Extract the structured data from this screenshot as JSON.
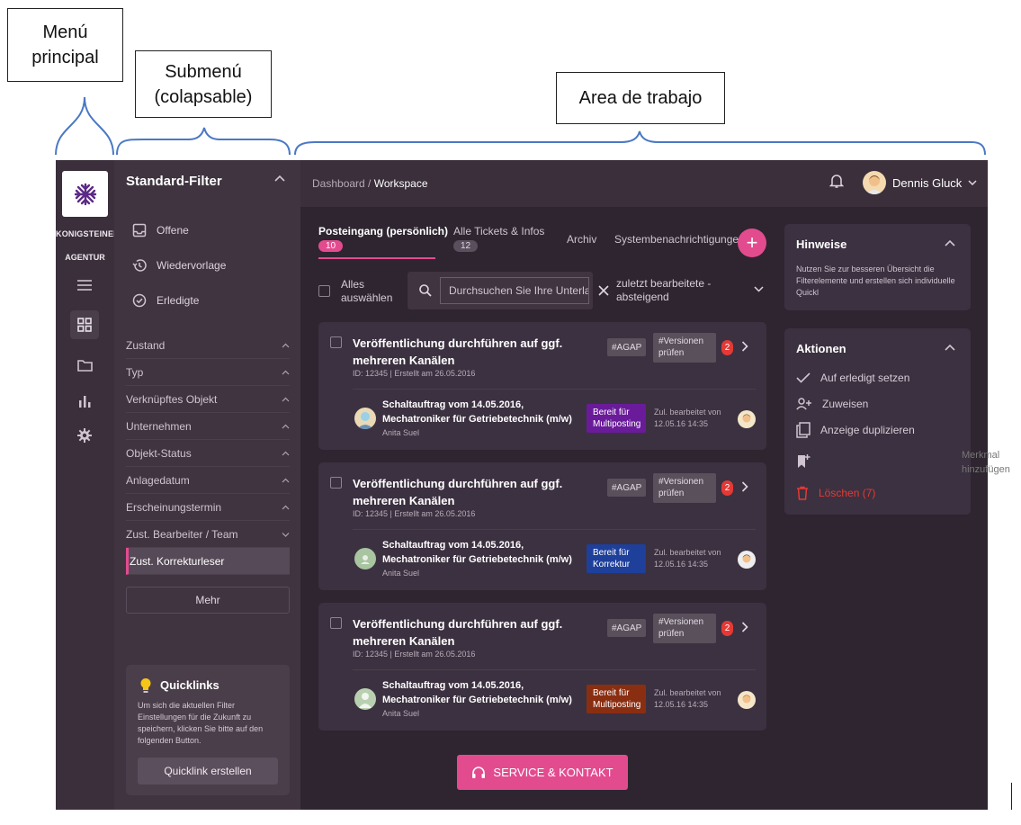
{
  "annotations": {
    "main_menu": "Menú principal",
    "submenu": "Submenú (colapsable)",
    "workarea": "Area de trabajo"
  },
  "rail": {
    "brand_line1": "KONIGSTEINER",
    "brand_line2": "AGENTUR",
    "icons": [
      "menu-icon",
      "dashboard-icon",
      "folder-icon",
      "chart-icon",
      "gear-icon"
    ]
  },
  "submenu": {
    "title": "Standard-Filter",
    "items": [
      {
        "label": "Offene",
        "icon": "inbox-icon"
      },
      {
        "label": "Wiedervorlage",
        "icon": "history-icon"
      },
      {
        "label": "Erledigte",
        "icon": "check-circle-icon"
      }
    ],
    "filters": [
      {
        "label": "Zustand"
      },
      {
        "label": "Typ"
      },
      {
        "label": "Verknüpftes Objekt"
      },
      {
        "label": "Unternehmen"
      },
      {
        "label": "Objekt-Status"
      },
      {
        "label": "Anlagedatum"
      },
      {
        "label": "Erscheinungstermin"
      },
      {
        "label": "Zust. Bearbeiter / Team"
      },
      {
        "label": "Zust. Korrekturleser"
      }
    ],
    "more_label": "Mehr",
    "quicklinks": {
      "title": "Quicklinks",
      "text": "Um sich die aktuellen Filter Einstellungen für die Zukunft zu speichern, klicken Sie bitte auf den folgenden Button.",
      "button": "Quicklink erstellen"
    }
  },
  "topbar": {
    "breadcrumb_root": "Dashboard /",
    "breadcrumb_current": "Workspace",
    "user_name": "Dennis Gluck"
  },
  "tabs": [
    {
      "label": "Posteingang (persönlich)",
      "badge": "10"
    },
    {
      "label": "Alle Tickets & Infos",
      "badge": "12"
    },
    {
      "label": "Archiv"
    },
    {
      "label": "Systembenachrichtigungen"
    }
  ],
  "toolbar": {
    "select_all": "Alles auswählen",
    "search_placeholder": "Durchsuchen Sie Ihre Unterlagen",
    "sort_label": "zuletzt bearbeitete - absteigend"
  },
  "cards": [
    {
      "title": "Veröffentlichung durchführen auf ggf. mehreren Kanälen",
      "meta": "ID: 12345 | Erstellt am 26.05.2016",
      "tag1": "#AGAP",
      "tag2": "#Versionen prüfen",
      "count": "2",
      "sub_title": "Schaltauftrag vom 14.05.2016, Mechatroniker für Getriebetechnik (m/w)",
      "person": "Anita Suel",
      "status": "Bereit für Multiposting",
      "status_color": "#6a1b9a",
      "edited": "Zul. bearbeitet von 12.05.16 14:35"
    },
    {
      "title": "Veröffentlichung durchführen auf ggf. mehreren Kanälen",
      "meta": "ID: 12345 | Erstellt am 26.05.2016",
      "tag1": "#AGAP",
      "tag2": "#Versionen prüfen",
      "count": "2",
      "sub_title": "Schaltauftrag vom 14.05.2016, Mechatroniker für Getriebetechnik (m/w)",
      "person": "Anita Suel",
      "status": "Bereit für Korrektur",
      "status_color": "#1e3f9a",
      "edited": "Zul. bearbeitet von 12.05.16 14:35"
    },
    {
      "title": "Veröffentlichung durchführen auf ggf. mehreren Kanälen",
      "meta": "ID: 12345 | Erstellt am 26.05.2016",
      "tag1": "#AGAP",
      "tag2": "#Versionen prüfen",
      "count": "2",
      "sub_title": "Schaltauftrag vom 14.05.2016, Mechatroniker für Getriebetechnik (m/w)",
      "person": "Anita Suel",
      "status": "Bereit für Multiposting",
      "status_color": "#8a2e12",
      "edited": "Zul. bearbeitet von 12.05.16 14:35"
    }
  ],
  "service_button": "SERVICE & KONTAKT",
  "hints": {
    "title": "Hinweise",
    "text": "Nutzen Sie zur besseren Übersicht die Filterelemente und erstellen sich individuelle Quickl"
  },
  "actions": {
    "title": "Aktionen",
    "items": [
      {
        "label": "Auf erledigt setzen",
        "icon": "check-icon"
      },
      {
        "label": "Zuweisen",
        "icon": "person-add-icon"
      },
      {
        "label": "Anzeige duplizieren",
        "icon": "copy-icon"
      },
      {
        "label": "",
        "icon": "bookmark-add-icon"
      },
      {
        "label": "Löschen (7)",
        "icon": "trash-icon"
      }
    ],
    "overflow_label": "Merkmal hinzufügen"
  },
  "colors": {
    "accent": "#e34b8f",
    "rail": "#3a2f3b",
    "panel": "#3f3440",
    "background": "#2e2530",
    "card": "#3c3140",
    "delete": "#e53935"
  }
}
